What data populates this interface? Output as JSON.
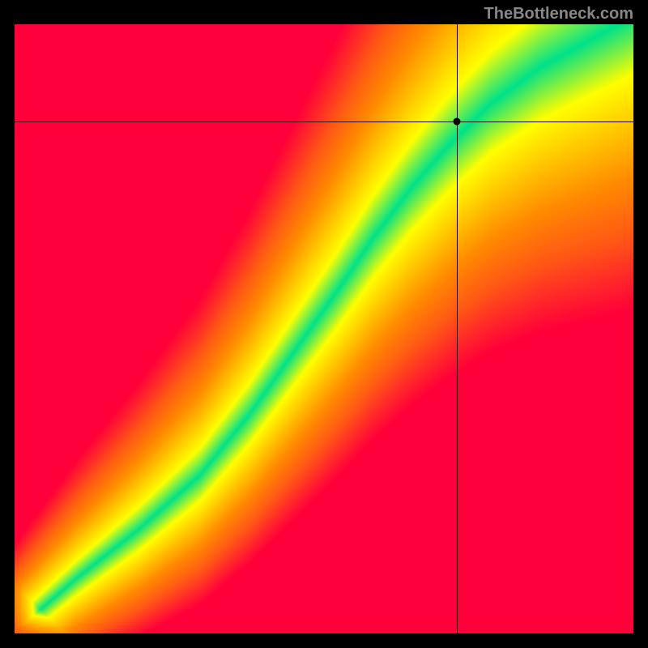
{
  "watermark": "TheBottleneck.com",
  "chart_data": {
    "type": "heatmap",
    "title": "",
    "xlabel": "",
    "ylabel": "",
    "xlim": [
      0,
      100
    ],
    "ylim": [
      0,
      100
    ],
    "color_scale": {
      "low": "#ff003a",
      "mid_low": "#ff8c00",
      "mid": "#ffff00",
      "high": "#00e28a"
    },
    "ridge_description": "Diagonal green optimal band running from bottom-left to top-right with slight S-curve; colors transition outward through yellow and orange to red indicating bottleneck severity.",
    "crosshair": {
      "x": 71.5,
      "y": 84.0
    },
    "marker_point": {
      "x": 71.5,
      "y": 84.0
    },
    "ridge_samples": [
      {
        "x": 2,
        "y": 2
      },
      {
        "x": 10,
        "y": 9
      },
      {
        "x": 20,
        "y": 17
      },
      {
        "x": 30,
        "y": 26
      },
      {
        "x": 38,
        "y": 36
      },
      {
        "x": 45,
        "y": 46
      },
      {
        "x": 52,
        "y": 56
      },
      {
        "x": 58,
        "y": 65
      },
      {
        "x": 64,
        "y": 73
      },
      {
        "x": 70,
        "y": 80
      },
      {
        "x": 77,
        "y": 87
      },
      {
        "x": 85,
        "y": 93
      },
      {
        "x": 94,
        "y": 98
      }
    ]
  }
}
